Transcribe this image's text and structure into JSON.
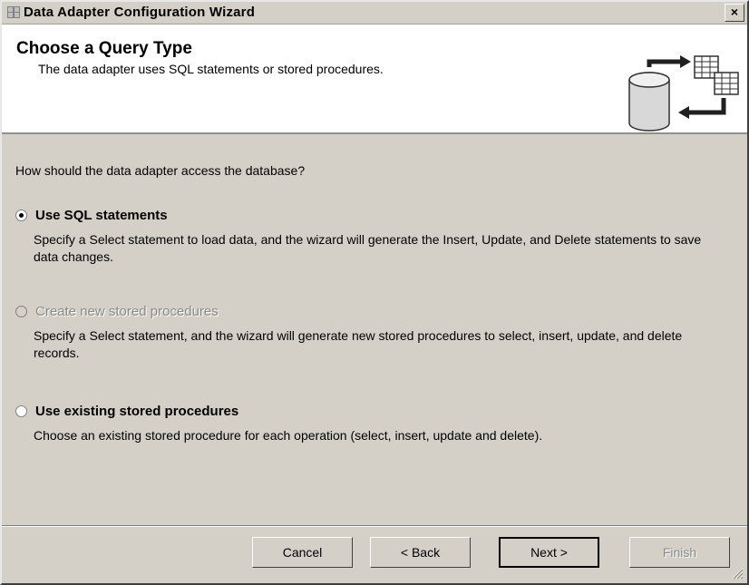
{
  "window": {
    "title": "Data Adapter Configuration Wizard",
    "close_label": "×"
  },
  "header": {
    "title": "Choose a Query Type",
    "subtitle": "The data adapter uses SQL statements or stored procedures."
  },
  "prompt": "How should the data adapter access the database?",
  "options": [
    {
      "label": "Use SQL statements",
      "description": "Specify a Select statement to load data, and the wizard will generate the Insert, Update, and Delete statements to save data changes.",
      "selected": true,
      "enabled": true
    },
    {
      "label": "Create new stored procedures",
      "description": "Specify a Select statement, and the wizard will generate new stored procedures to select, insert, update, and delete records.",
      "selected": false,
      "enabled": false
    },
    {
      "label": "Use existing stored procedures",
      "description": "Choose an existing stored procedure for each operation (select, insert, update and delete).",
      "selected": false,
      "enabled": true
    }
  ],
  "buttons": {
    "cancel": "Cancel",
    "back": "< Back",
    "next": "Next >",
    "finish": "Finish"
  },
  "colors": {
    "face": "#d4d0c8",
    "header_bg": "#ffffff",
    "disabled_text": "#8a8a8a"
  }
}
